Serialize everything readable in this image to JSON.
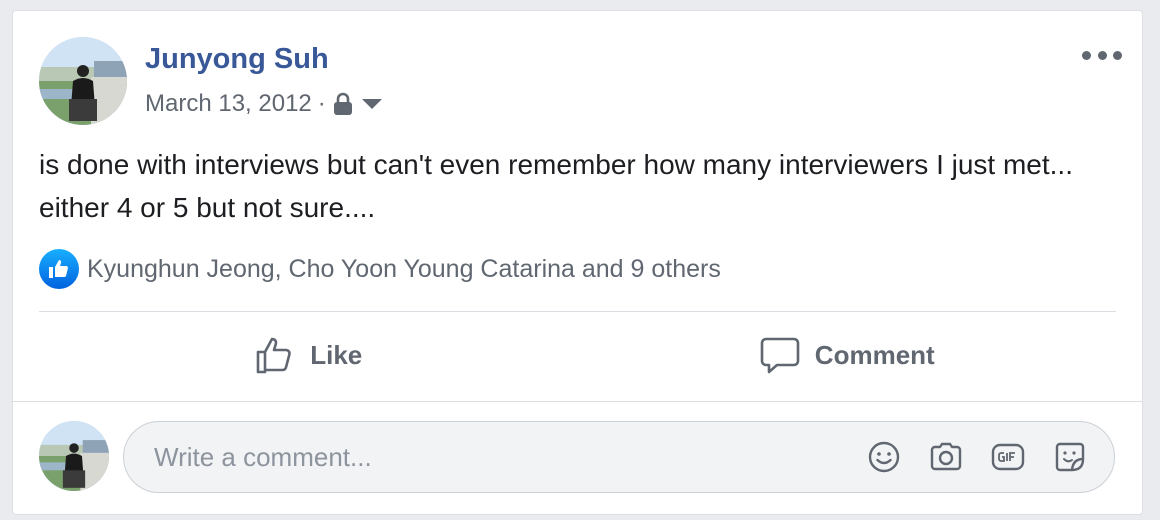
{
  "post": {
    "author": "Junyong Suh",
    "date": "March 13, 2012",
    "separator": "·",
    "privacy_icon": "lock-icon",
    "text": "is done with interviews but can't even remember how many interviewers I just met... either 4 or 5 but not sure....",
    "reactions_text": "Kyunghun Jeong, Cho Yoon Young Catarina and 9 others"
  },
  "actions": {
    "like_label": "Like",
    "comment_label": "Comment"
  },
  "comment_box": {
    "placeholder": "Write a comment...",
    "tools": [
      "emoji-icon",
      "camera-icon",
      "gif-icon",
      "sticker-icon"
    ]
  },
  "colors": {
    "author_link": "#385898",
    "secondary_text": "#606770",
    "like_blue": "#1877f2"
  }
}
